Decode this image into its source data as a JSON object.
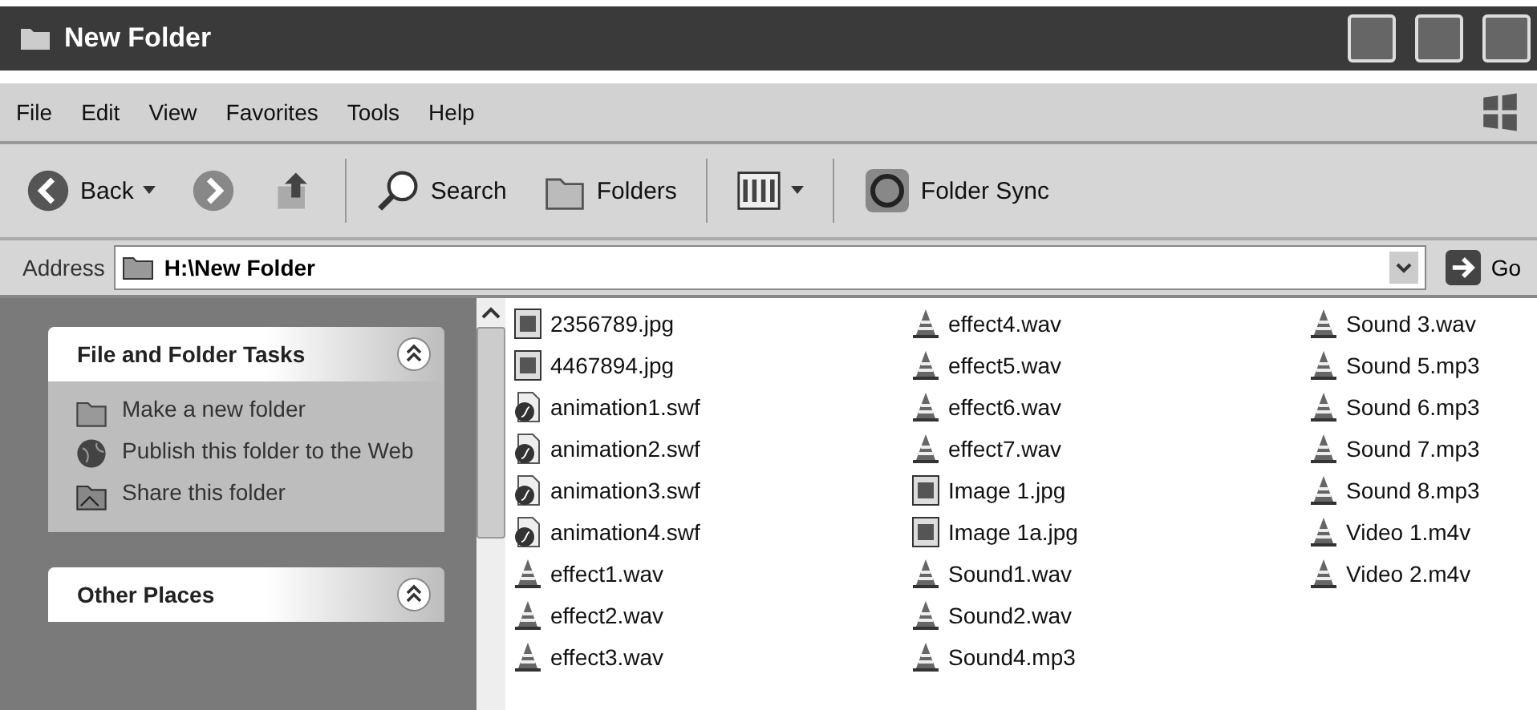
{
  "window": {
    "title": "New Folder"
  },
  "menu": [
    "File",
    "Edit",
    "View",
    "Favorites",
    "Tools",
    "Help"
  ],
  "toolbar": [
    {
      "kind": "back",
      "label": "Back"
    },
    {
      "kind": "forward"
    },
    {
      "kind": "up"
    },
    {
      "kind": "search",
      "label": "Search"
    },
    {
      "kind": "folders",
      "label": "Folders"
    },
    {
      "kind": "views"
    },
    {
      "kind": "sync",
      "label": "Folder Sync"
    }
  ],
  "address": {
    "label": "Address",
    "value": "H:\\New Folder",
    "go": "Go"
  },
  "panels": [
    {
      "title": "File and Folder Tasks",
      "items": [
        {
          "kind": "newfolder",
          "label": "Make a new folder"
        },
        {
          "kind": "publish",
          "label": "Publish this folder to the Web"
        },
        {
          "kind": "share",
          "label": "Share this folder"
        }
      ]
    },
    {
      "title": "Other Places"
    }
  ],
  "files": [
    {
      "kind": "image",
      "name": "2356789.jpg"
    },
    {
      "kind": "image",
      "name": "4467894.jpg"
    },
    {
      "kind": "flash",
      "name": "animation1.swf"
    },
    {
      "kind": "flash",
      "name": "animation2.swf"
    },
    {
      "kind": "flash",
      "name": "animation3.swf"
    },
    {
      "kind": "flash",
      "name": "animation4.swf"
    },
    {
      "kind": "cone",
      "name": "effect1.wav"
    },
    {
      "kind": "cone",
      "name": "effect2.wav"
    },
    {
      "kind": "cone",
      "name": "effect3.wav"
    },
    {
      "kind": "cone",
      "name": "effect4.wav"
    },
    {
      "kind": "cone",
      "name": "effect5.wav"
    },
    {
      "kind": "cone",
      "name": "effect6.wav"
    },
    {
      "kind": "cone",
      "name": "effect7.wav"
    },
    {
      "kind": "image",
      "name": "Image 1.jpg"
    },
    {
      "kind": "image",
      "name": "Image 1a.jpg"
    },
    {
      "kind": "cone",
      "name": "Sound1.wav"
    },
    {
      "kind": "cone",
      "name": "Sound2.wav"
    },
    {
      "kind": "cone",
      "name": "Sound4.mp3"
    },
    {
      "kind": "cone",
      "name": "Sound 3.wav"
    },
    {
      "kind": "cone",
      "name": "Sound 5.mp3"
    },
    {
      "kind": "cone",
      "name": "Sound 6.mp3"
    },
    {
      "kind": "cone",
      "name": "Sound 7.mp3"
    },
    {
      "kind": "cone",
      "name": "Sound 8.mp3"
    },
    {
      "kind": "cone",
      "name": "Video 1.m4v"
    },
    {
      "kind": "cone",
      "name": "Video 2.m4v"
    }
  ]
}
